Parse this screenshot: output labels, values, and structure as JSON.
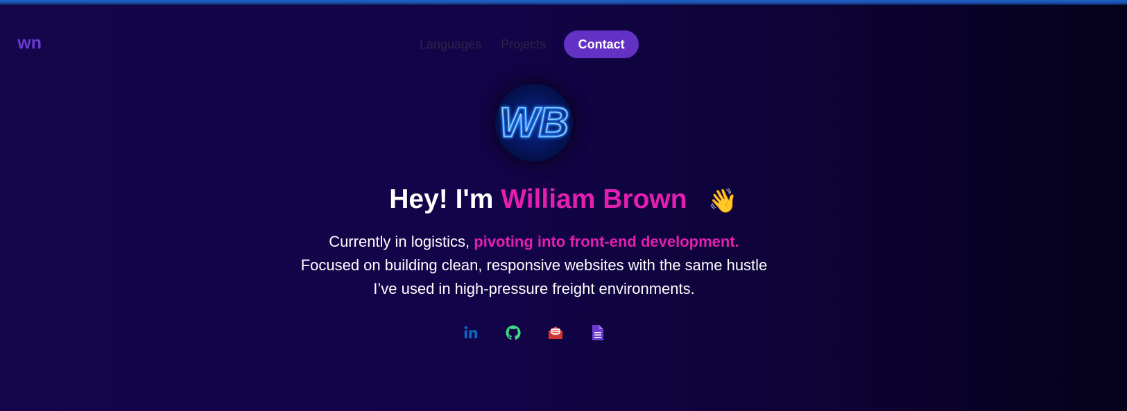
{
  "header": {
    "brand_text": "wn",
    "nav": {
      "languages_label": "Languages",
      "projects_label": "Projects",
      "contact_label": "Contact"
    }
  },
  "hero": {
    "avatar_monogram": "WB",
    "greeting": "Hey! I'm",
    "name": "William Brown",
    "wave_emoji": "👋",
    "intro_before": "Currently in logistics, ",
    "intro_highlight": "pivoting into front-end development.",
    "intro_after": " Focused on building clean, responsive websites with the same hustle I’ve used in high-pressure freight environments."
  },
  "socials": [
    {
      "icon": "linkedin-icon",
      "color": "#0a66c2"
    },
    {
      "icon": "github-icon",
      "color": "#3ddc84"
    },
    {
      "icon": "mail-open-icon",
      "color": "#e8453c"
    },
    {
      "icon": "document-icon",
      "color": "#6a3bd0"
    }
  ],
  "colors": {
    "accent_pink": "#e21fb0",
    "accent_purple": "#6331c4",
    "background_start": "#15054a",
    "background_end": "#05011a"
  }
}
